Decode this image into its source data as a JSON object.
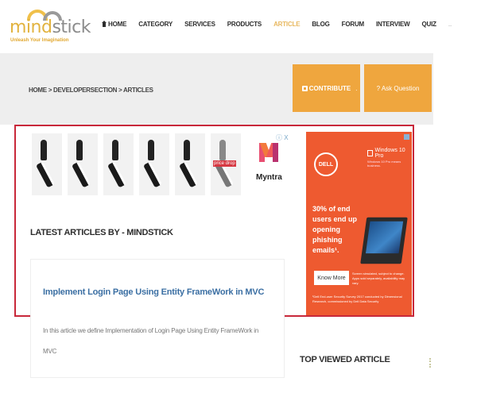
{
  "brand": {
    "logo_part1": "mind",
    "logo_part2": "stick",
    "tagline": "Unleash Your Imagination"
  },
  "nav": {
    "items": [
      {
        "label": "HOME",
        "icon": "home-icon"
      },
      {
        "label": "CATEGORY"
      },
      {
        "label": "SERVICES"
      },
      {
        "label": "PRODUCTS"
      },
      {
        "label": "ARTICLE",
        "active": true
      },
      {
        "label": "BLOG"
      },
      {
        "label": "FORUM"
      },
      {
        "label": "INTERVIEW"
      },
      {
        "label": "QUIZ"
      }
    ],
    "more": "..",
    "active_color": "#e8b860"
  },
  "breadcrumb": "HOME > DEVELOPERSECTION > ARTICLES",
  "actions": {
    "contribute_label": "CONTRIBUTE",
    "separator": "·",
    "ask_label": "? Ask Question",
    "button_color": "#efa63e"
  },
  "ads": {
    "myntra": {
      "price_badge": "price drop",
      "brand": "Myntra",
      "adchoice": "ⓘ X"
    },
    "dell": {
      "logo": "DELL",
      "windows": "Windows 10 Pro",
      "windows_sub": "Windows 10 Pro means business.",
      "headline": "30% of end users end up opening phishing emails¹.",
      "cta": "Know More",
      "fine_print": "Screen simulated, subject to change. Apps sold separately, availability may vary.",
      "footer": "¹Dell End-user Security Survey 2017 conducted by Dimensional Research, commissioned by Dell Data Security",
      "bg_color": "#ee5a30"
    }
  },
  "main": {
    "section_title": "LATEST ARTICLES BY - MINDSTICK",
    "articles": [
      {
        "title": "Implement Login Page Using Entity FrameWork in MVC",
        "description": "In this article we define Implementation of Login Page Using Entity FrameWork in MVC"
      }
    ]
  },
  "sidebar": {
    "top_viewed_title": "TOP VIEWED ARTICLE"
  },
  "highlight_color": "#c8283a"
}
